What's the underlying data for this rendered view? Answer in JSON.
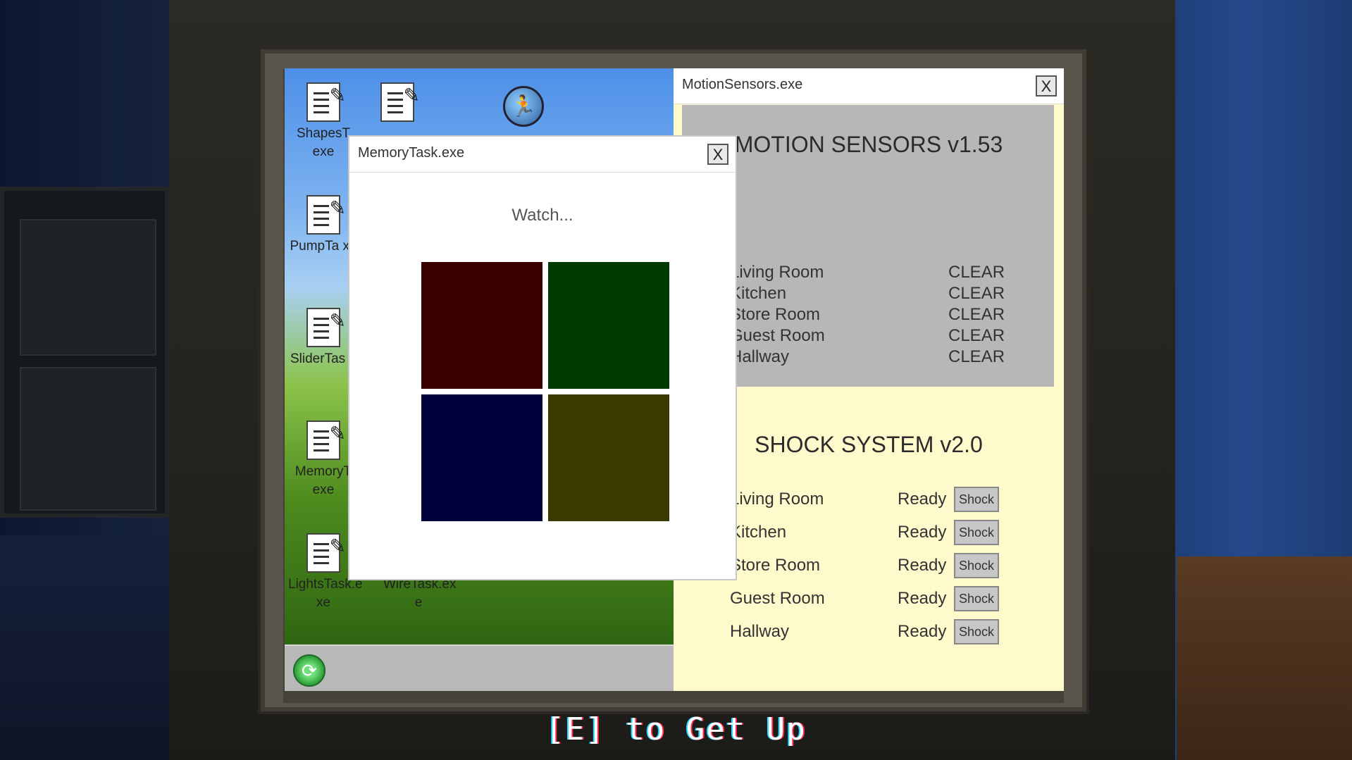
{
  "desktop": {
    "icons": [
      {
        "label": "ShapesT exe"
      },
      {
        "label": "PumpTa xe"
      },
      {
        "label": "SliderTas e"
      },
      {
        "label": "MemoryT exe"
      },
      {
        "label": "LightsTask.e xe"
      },
      {
        "label": "WireTask.ex e"
      }
    ],
    "globe_icon": "runner-globe-icon",
    "start_icon": "refresh-start-icon"
  },
  "memory_window": {
    "title": "MemoryTask.exe",
    "close": "X",
    "prompt": "Watch...",
    "colors": [
      "#3a0000",
      "#003a00",
      "#00003a",
      "#3a3a00"
    ]
  },
  "motion_window": {
    "title": "MotionSensors.exe",
    "close": "X",
    "motion": {
      "heading": "MOTION SENSORS v1.53",
      "rooms": [
        {
          "name": "Living Room",
          "status": "CLEAR"
        },
        {
          "name": "Kitchen",
          "status": "CLEAR"
        },
        {
          "name": "Store Room",
          "status": "CLEAR"
        },
        {
          "name": "Guest Room",
          "status": "CLEAR"
        },
        {
          "name": "Hallway",
          "status": "CLEAR"
        }
      ]
    },
    "shock": {
      "heading": "SHOCK SYSTEM v2.0",
      "rooms": [
        {
          "name": "Living Room",
          "status": "Ready",
          "button": "Shock"
        },
        {
          "name": "Kitchen",
          "status": "Ready",
          "button": "Shock"
        },
        {
          "name": "Store Room",
          "status": "Ready",
          "button": "Shock"
        },
        {
          "name": "Guest Room",
          "status": "Ready",
          "button": "Shock"
        },
        {
          "name": "Hallway",
          "status": "Ready",
          "button": "Shock"
        }
      ]
    }
  },
  "caption": "[E] to Get Up"
}
